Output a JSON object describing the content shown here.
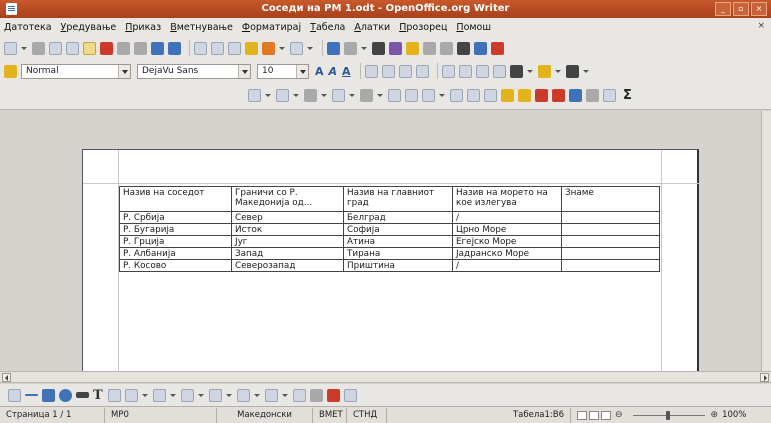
{
  "window": {
    "title": "Соседи на РМ 1.odt - OpenOffice.org Writer",
    "buttons": [
      "_",
      "▫",
      "×"
    ],
    "colors": {
      "titlebar": "#b84a22"
    }
  },
  "menubar": {
    "items": [
      "Датотека",
      "Уредување",
      "Приказ",
      "Вметнување",
      "Форматирај",
      "Табела",
      "Алатки",
      "Прозорец",
      "Помош"
    ],
    "close_glyph": "×"
  },
  "formatting": {
    "style": "Normal",
    "font": "DejaVu Sans",
    "size": "10",
    "font_letters": [
      "A",
      "A",
      "A"
    ],
    "sigma": "Σ"
  },
  "table": {
    "headers": [
      "Назив на соседот",
      "Граничи со Р. Македонија од...",
      "Назив на главниот град",
      "Назив на морето на кое излегува",
      "Знаме"
    ],
    "rows": [
      [
        "Р. Србија",
        "Север",
        "Белград",
        "/",
        ""
      ],
      [
        "Р. Бугарија",
        "Исток",
        "Софија",
        "Црно Море",
        ""
      ],
      [
        "Р. Грција",
        "Југ",
        "Атина",
        "Егејско Море",
        ""
      ],
      [
        "Р. Албанија",
        "Запад",
        "Тирана",
        "Јадранско Море",
        ""
      ],
      [
        "Р. Косово",
        "Северозапад",
        "Приштина",
        "/",
        ""
      ]
    ]
  },
  "drawing": {
    "text_tool": "T"
  },
  "statusbar": {
    "page": "Страница 1 / 1",
    "style": "MP0",
    "language": "Македонски",
    "insert_mode": "ВМЕТ",
    "selection_mode": "СТНД",
    "cell": "Табела1:B6",
    "zoom_minus": "⊖",
    "zoom_plus": "⊕",
    "zoom": "100%"
  }
}
